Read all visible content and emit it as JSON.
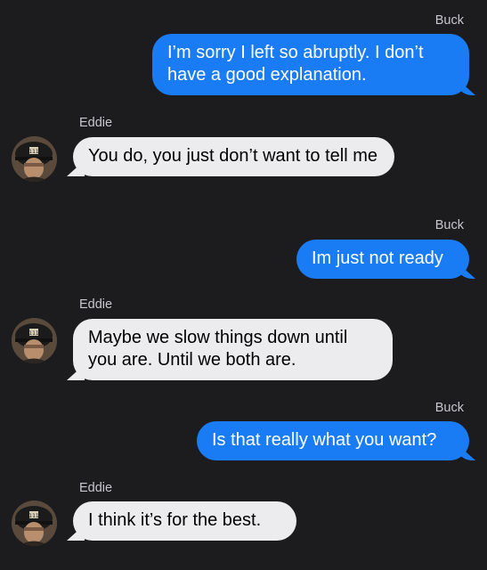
{
  "messages": [
    {
      "sender": "Buck",
      "direction": "outgoing",
      "text": "I’m sorry I left so abruptly. I don’t have a good explanation."
    },
    {
      "sender": "Eddie",
      "direction": "incoming",
      "text": "You do, you just don’t want to tell me",
      "avatar": "firefighter-avatar"
    },
    {
      "sender": "Buck",
      "direction": "outgoing",
      "text": "Im just not ready"
    },
    {
      "sender": "Eddie",
      "direction": "incoming",
      "text": "Maybe we slow things down until you are. Until we both are.",
      "avatar": "firefighter-avatar"
    },
    {
      "sender": "Buck",
      "direction": "outgoing",
      "text": "Is that really what you want?"
    },
    {
      "sender": "Eddie",
      "direction": "incoming",
      "text": "I think it’s for the best.",
      "avatar": "firefighter-avatar"
    }
  ],
  "colors": {
    "background": "#1c1c1e",
    "outgoing_bubble": "#1a7cf5",
    "incoming_bubble": "#ececef",
    "sender_label": "#c7c7cc"
  }
}
